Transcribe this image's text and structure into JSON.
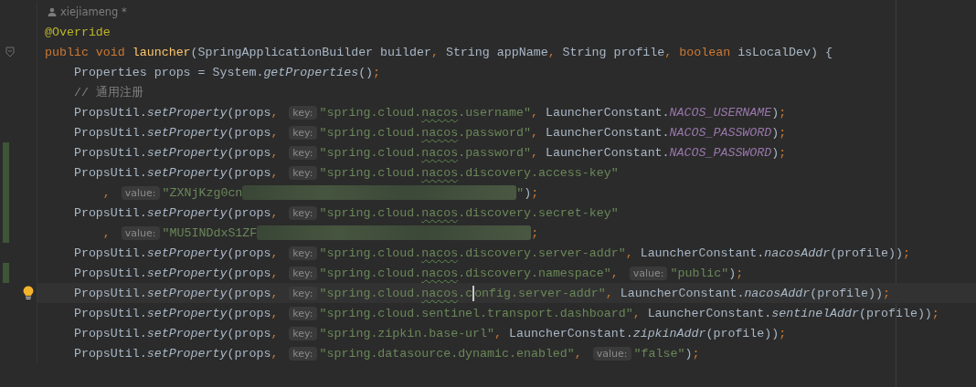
{
  "author": {
    "name": "xiejiameng *"
  },
  "lines": [
    {
      "changed": false,
      "current": false,
      "tokens": [
        {
          "kind": "ann",
          "text": "@Override"
        }
      ]
    },
    {
      "gutter": {
        "kind": "fold"
      },
      "changed": false,
      "current": false,
      "tokens": [
        {
          "kind": "kw",
          "text": "public void "
        },
        {
          "kind": "decl",
          "text": "launcher"
        },
        {
          "kind": "plain",
          "text": "(SpringApplicationBuilder builder"
        },
        {
          "kind": "punct",
          "text": ", "
        },
        {
          "kind": "plain",
          "text": "String appName"
        },
        {
          "kind": "punct",
          "text": ", "
        },
        {
          "kind": "plain",
          "text": "String profile"
        },
        {
          "kind": "punct",
          "text": ", "
        },
        {
          "kind": "kw",
          "text": "boolean "
        },
        {
          "kind": "plain",
          "text": "isLocalDev) {"
        }
      ]
    },
    {
      "changed": false,
      "current": false,
      "tokens": [
        {
          "kind": "plain",
          "text": "    Properties props = System."
        },
        {
          "kind": "call",
          "text": "getProperties"
        },
        {
          "kind": "plain",
          "text": "()"
        },
        {
          "kind": "punct",
          "text": ";"
        }
      ]
    },
    {
      "changed": false,
      "current": false,
      "tokens": [
        {
          "kind": "comment",
          "text": "    // 通用注册"
        }
      ]
    },
    {
      "changed": false,
      "current": false,
      "tokens": [
        {
          "kind": "plain",
          "text": "    PropsUtil."
        },
        {
          "kind": "call",
          "text": "setProperty"
        },
        {
          "kind": "plain",
          "text": "(props"
        },
        {
          "kind": "punct",
          "text": ", "
        },
        {
          "kind": "hint",
          "text": "key:"
        },
        {
          "kind": "str",
          "text": "\"spring.cloud."
        },
        {
          "kind": "typo",
          "text": "nacos"
        },
        {
          "kind": "str",
          "text": ".username\""
        },
        {
          "kind": "punct",
          "text": ", "
        },
        {
          "kind": "plain",
          "text": "LauncherConstant."
        },
        {
          "kind": "const",
          "text": "NACOS_USERNAME"
        },
        {
          "kind": "plain",
          "text": ")"
        },
        {
          "kind": "punct",
          "text": ";"
        }
      ]
    },
    {
      "changed": false,
      "current": false,
      "tokens": [
        {
          "kind": "plain",
          "text": "    PropsUtil."
        },
        {
          "kind": "call",
          "text": "setProperty"
        },
        {
          "kind": "plain",
          "text": "(props"
        },
        {
          "kind": "punct",
          "text": ", "
        },
        {
          "kind": "hint",
          "text": "key:"
        },
        {
          "kind": "str",
          "text": "\"spring.cloud."
        },
        {
          "kind": "typo",
          "text": "nacos"
        },
        {
          "kind": "str",
          "text": ".password\""
        },
        {
          "kind": "punct",
          "text": ", "
        },
        {
          "kind": "plain",
          "text": "LauncherConstant."
        },
        {
          "kind": "const",
          "text": "NACOS_PASSWORD"
        },
        {
          "kind": "plain",
          "text": ")"
        },
        {
          "kind": "punct",
          "text": ";"
        }
      ]
    },
    {
      "changed": true,
      "current": false,
      "tokens": [
        {
          "kind": "plain",
          "text": "    PropsUtil."
        },
        {
          "kind": "call",
          "text": "setProperty"
        },
        {
          "kind": "plain",
          "text": "(props"
        },
        {
          "kind": "punct",
          "text": ", "
        },
        {
          "kind": "hint",
          "text": "key:"
        },
        {
          "kind": "str",
          "text": "\"spring.cloud."
        },
        {
          "kind": "typo",
          "text": "nacos"
        },
        {
          "kind": "str",
          "text": ".password\""
        },
        {
          "kind": "punct",
          "text": ", "
        },
        {
          "kind": "plain",
          "text": "LauncherConstant."
        },
        {
          "kind": "const",
          "text": "NACOS_PASSWORD"
        },
        {
          "kind": "plain",
          "text": ")"
        },
        {
          "kind": "punct",
          "text": ";"
        }
      ]
    },
    {
      "changed": true,
      "current": false,
      "tokens": [
        {
          "kind": "plain",
          "text": "    PropsUtil."
        },
        {
          "kind": "call",
          "text": "setProperty"
        },
        {
          "kind": "plain",
          "text": "(props"
        },
        {
          "kind": "punct",
          "text": ", "
        },
        {
          "kind": "hint",
          "text": "key:"
        },
        {
          "kind": "str",
          "text": "\"spring.cloud."
        },
        {
          "kind": "typo",
          "text": "nacos"
        },
        {
          "kind": "str",
          "text": ".discovery.access-key\""
        }
      ]
    },
    {
      "changed": true,
      "current": false,
      "tokens": [
        {
          "kind": "punct",
          "text": "        , "
        },
        {
          "kind": "hint",
          "text": "value:"
        },
        {
          "kind": "str",
          "text": "\"ZXNjKzg0cn"
        },
        {
          "kind": "redacted"
        },
        {
          "kind": "str",
          "text": "\""
        },
        {
          "kind": "plain",
          "text": ")"
        },
        {
          "kind": "punct",
          "text": ";"
        }
      ]
    },
    {
      "changed": true,
      "current": false,
      "tokens": [
        {
          "kind": "plain",
          "text": "    PropsUtil."
        },
        {
          "kind": "call",
          "text": "setProperty"
        },
        {
          "kind": "plain",
          "text": "(props"
        },
        {
          "kind": "punct",
          "text": ", "
        },
        {
          "kind": "hint",
          "text": "key:"
        },
        {
          "kind": "str",
          "text": "\"spring.cloud."
        },
        {
          "kind": "typo",
          "text": "nacos"
        },
        {
          "kind": "str",
          "text": ".discovery.secret-key\""
        }
      ]
    },
    {
      "changed": true,
      "current": false,
      "tokens": [
        {
          "kind": "punct",
          "text": "        , "
        },
        {
          "kind": "hint",
          "text": "value:"
        },
        {
          "kind": "str",
          "text": "\"MU5INDdxS1ZF"
        },
        {
          "kind": "redacted"
        },
        {
          "kind": "punct",
          "text": ";"
        }
      ]
    },
    {
      "changed": false,
      "current": false,
      "tokens": [
        {
          "kind": "plain",
          "text": "    PropsUtil."
        },
        {
          "kind": "call",
          "text": "setProperty"
        },
        {
          "kind": "plain",
          "text": "(props"
        },
        {
          "kind": "punct",
          "text": ", "
        },
        {
          "kind": "hint",
          "text": "key:"
        },
        {
          "kind": "str",
          "text": "\"spring.cloud."
        },
        {
          "kind": "typo",
          "text": "nacos"
        },
        {
          "kind": "str",
          "text": ".discovery.server-addr\""
        },
        {
          "kind": "punct",
          "text": ", "
        },
        {
          "kind": "plain",
          "text": "LauncherConstant."
        },
        {
          "kind": "call",
          "text": "nacosAddr"
        },
        {
          "kind": "plain",
          "text": "(profile))"
        },
        {
          "kind": "punct",
          "text": ";"
        }
      ]
    },
    {
      "changed": true,
      "current": false,
      "tokens": [
        {
          "kind": "plain",
          "text": "    PropsUtil."
        },
        {
          "kind": "call",
          "text": "setProperty"
        },
        {
          "kind": "plain",
          "text": "(props"
        },
        {
          "kind": "punct",
          "text": ", "
        },
        {
          "kind": "hint",
          "text": "key:"
        },
        {
          "kind": "str",
          "text": "\"spring.cloud."
        },
        {
          "kind": "typo",
          "text": "nacos"
        },
        {
          "kind": "str",
          "text": ".discovery.namespace\""
        },
        {
          "kind": "punct",
          "text": ", "
        },
        {
          "kind": "hint",
          "text": "value:"
        },
        {
          "kind": "str",
          "text": "\"public\""
        },
        {
          "kind": "plain",
          "text": ")"
        },
        {
          "kind": "punct",
          "text": ";"
        }
      ]
    },
    {
      "gutter": {
        "kind": "bulb"
      },
      "changed": false,
      "current": true,
      "tokens": [
        {
          "kind": "plain",
          "text": "    PropsUtil."
        },
        {
          "kind": "call",
          "text": "setProperty"
        },
        {
          "kind": "plain",
          "text": "(props"
        },
        {
          "kind": "punct",
          "text": ", "
        },
        {
          "kind": "hint",
          "text": "key:"
        },
        {
          "kind": "str",
          "text": "\"spring.cloud."
        },
        {
          "kind": "typo",
          "text": "nacos"
        },
        {
          "kind": "str",
          "text": ".c"
        },
        {
          "kind": "caret"
        },
        {
          "kind": "str",
          "text": "onfig.server-addr\""
        },
        {
          "kind": "punct",
          "text": ", "
        },
        {
          "kind": "plain",
          "text": "LauncherConstant."
        },
        {
          "kind": "call",
          "text": "nacosAddr"
        },
        {
          "kind": "plain",
          "text": "(profile))"
        },
        {
          "kind": "punct",
          "text": ";"
        }
      ]
    },
    {
      "changed": false,
      "current": false,
      "tokens": [
        {
          "kind": "plain",
          "text": "    PropsUtil."
        },
        {
          "kind": "call",
          "text": "setProperty"
        },
        {
          "kind": "plain",
          "text": "(props"
        },
        {
          "kind": "punct",
          "text": ", "
        },
        {
          "kind": "hint",
          "text": "key:"
        },
        {
          "kind": "str",
          "text": "\"spring.cloud.sentinel.transport.dashboard\""
        },
        {
          "kind": "punct",
          "text": ", "
        },
        {
          "kind": "plain",
          "text": "LauncherConstant."
        },
        {
          "kind": "call",
          "text": "sentinelAddr"
        },
        {
          "kind": "plain",
          "text": "(profile))"
        },
        {
          "kind": "punct",
          "text": ";"
        }
      ]
    },
    {
      "changed": false,
      "current": false,
      "tokens": [
        {
          "kind": "plain",
          "text": "    PropsUtil."
        },
        {
          "kind": "call",
          "text": "setProperty"
        },
        {
          "kind": "plain",
          "text": "(props"
        },
        {
          "kind": "punct",
          "text": ", "
        },
        {
          "kind": "hint",
          "text": "key:"
        },
        {
          "kind": "str",
          "text": "\"spring.zipkin.base-url\""
        },
        {
          "kind": "punct",
          "text": ", "
        },
        {
          "kind": "plain",
          "text": "LauncherConstant."
        },
        {
          "kind": "call",
          "text": "zipkinAddr"
        },
        {
          "kind": "plain",
          "text": "(profile))"
        },
        {
          "kind": "punct",
          "text": ";"
        }
      ]
    },
    {
      "changed": false,
      "current": false,
      "tokens": [
        {
          "kind": "plain",
          "text": "    PropsUtil."
        },
        {
          "kind": "call",
          "text": "setProperty"
        },
        {
          "kind": "plain",
          "text": "(props"
        },
        {
          "kind": "punct",
          "text": ", "
        },
        {
          "kind": "hint",
          "text": "key:"
        },
        {
          "kind": "str",
          "text": "\"spring.datasource.dynamic.enabled\""
        },
        {
          "kind": "punct",
          "text": ", "
        },
        {
          "kind": "hint",
          "text": "value:"
        },
        {
          "kind": "str",
          "text": "\"false\""
        },
        {
          "kind": "plain",
          "text": ")"
        },
        {
          "kind": "punct",
          "text": ";"
        }
      ]
    }
  ]
}
